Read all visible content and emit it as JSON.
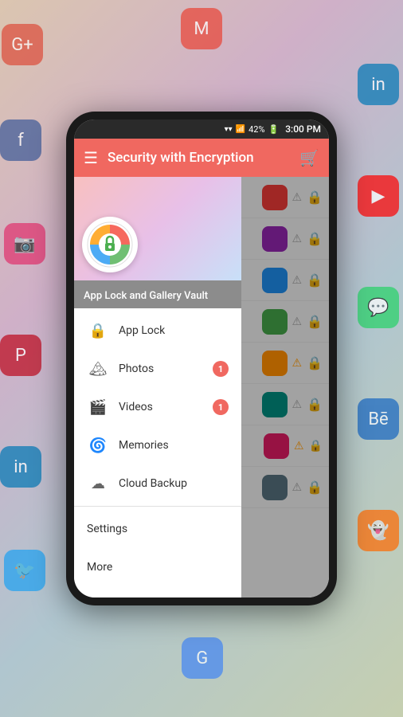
{
  "status_bar": {
    "wifi": "📶",
    "signal": "📶",
    "battery": "42%",
    "time": "3:00 PM"
  },
  "app_bar": {
    "title": "Security with Encryption",
    "hamburger": "☰",
    "cart_icon": "🛒"
  },
  "drawer": {
    "subtitle": "App Lock and Gallery Vault",
    "items": [
      {
        "id": "app-lock",
        "icon": "🔒",
        "label": "App Lock",
        "badge": null
      },
      {
        "id": "photos",
        "icon": "🏔",
        "label": "Photos",
        "badge": "1"
      },
      {
        "id": "videos",
        "icon": "🎬",
        "label": "Videos",
        "badge": "1"
      },
      {
        "id": "memories",
        "icon": "🌀",
        "label": "Memories",
        "badge": null
      },
      {
        "id": "cloud-backup",
        "icon": "☁",
        "label": "Cloud Backup",
        "badge": null
      }
    ],
    "section_settings": "Settings",
    "section_more": "More"
  },
  "app_rows": [
    {
      "app_color": "#e53935",
      "warning": "grey",
      "lock": "green"
    },
    {
      "app_color": "#8e24aa",
      "warning": "grey",
      "lock": "grey"
    },
    {
      "app_color": "#1e88e5",
      "warning": "grey",
      "lock": "green"
    },
    {
      "app_color": "#43a047",
      "warning": "grey",
      "lock": "green"
    },
    {
      "app_color": "#fb8c00",
      "warning": "yellow",
      "lock": "green"
    },
    {
      "app_color": "#00897b",
      "warning": "grey",
      "lock": "grey"
    },
    {
      "app_color": "#d81b60",
      "warning": "yellow",
      "lock": "yellow"
    },
    {
      "app_color": "#546e7a",
      "warning": "grey",
      "lock": "grey"
    }
  ],
  "colors": {
    "accent": "#f06860",
    "drawer_bg": "#fff",
    "status_bg": "#2a2a2a"
  }
}
